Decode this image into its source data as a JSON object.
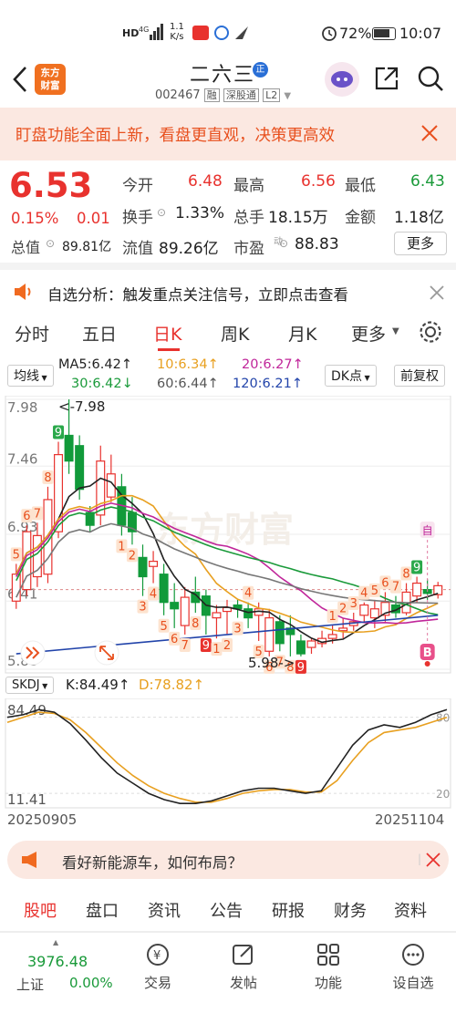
{
  "status_bar": {
    "net_speed": "1.1\nK/s",
    "battery": "72%",
    "time": "10:07"
  },
  "header": {
    "logo_text": "东方\n财富",
    "stock_name": "二六三",
    "badge": "正",
    "code": "002467",
    "tags": [
      "融",
      "深股通",
      "L2"
    ]
  },
  "banner": {
    "text": "盯盘功能全面上新，看盘更直观，决策更高效"
  },
  "quote": {
    "price": "6.53",
    "change_pct": "0.15%",
    "change_abs": "0.01",
    "open_label": "今开",
    "open": "6.48",
    "high_label": "最高",
    "high": "6.56",
    "low_label": "最低",
    "low": "6.43",
    "turnover_label": "换手",
    "turnover": "1.33%",
    "volume_label": "总手",
    "volume": "18.15万",
    "amount_label": "金额",
    "amount": "1.18亿",
    "mktcap_label": "总值",
    "mktcap": "89.81亿",
    "float_label": "流值",
    "float_cap": "89.26亿",
    "pe_label": "市盈",
    "pe": "88.83",
    "more": "更多"
  },
  "notice": {
    "text": "自选分析：触发重点关注信号，立即点击查看"
  },
  "chart_tabs": [
    "分时",
    "五日",
    "日K",
    "周K",
    "月K",
    "更多"
  ],
  "chart_tab_active": 2,
  "indicators": {
    "ma_type": "均线",
    "ma5": "MA5:6.42↑",
    "ma10": "10:6.34↑",
    "ma20": "20:6.27↑",
    "ma30": "30:6.42↓",
    "ma60": "60:6.44↑",
    "ma120": "120:6.21↑",
    "dk": "DK点",
    "adjust": "前复权",
    "colors": {
      "ma5": "#222222",
      "ma10": "#e8a020",
      "ma20": "#c0269a",
      "ma30": "#1a9a3a",
      "ma60": "#777777",
      "ma120": "#2244aa"
    }
  },
  "chart_data": {
    "type": "candlestick",
    "ylim": [
      5.88,
      7.98
    ],
    "y_ticks": [
      "7.98",
      "7.46",
      "6.93",
      "6.41",
      "5.88"
    ],
    "max_label": "<-7.98",
    "min_label": "5.98->",
    "watermark": "东方财富",
    "candles": [
      {
        "o": 6.41,
        "c": 6.62,
        "h": 6.7,
        "l": 6.35
      },
      {
        "o": 6.5,
        "c": 6.95,
        "h": 7.0,
        "l": 6.45
      },
      {
        "o": 6.6,
        "c": 6.92,
        "h": 7.02,
        "l": 6.52
      },
      {
        "o": 6.62,
        "c": 7.2,
        "h": 7.3,
        "l": 6.55
      },
      {
        "o": 6.95,
        "c": 7.55,
        "h": 7.65,
        "l": 6.9
      },
      {
        "o": 7.7,
        "c": 7.5,
        "h": 7.98,
        "l": 7.4
      },
      {
        "o": 7.62,
        "c": 7.28,
        "h": 7.7,
        "l": 7.2
      },
      {
        "o": 7.1,
        "c": 7.0,
        "h": 7.15,
        "l": 6.95
      },
      {
        "o": 7.08,
        "c": 7.5,
        "h": 7.62,
        "l": 7.0
      },
      {
        "o": 7.22,
        "c": 7.4,
        "h": 7.55,
        "l": 7.18
      },
      {
        "o": 7.3,
        "c": 7.0,
        "h": 7.4,
        "l": 6.92
      },
      {
        "o": 7.1,
        "c": 6.95,
        "h": 7.22,
        "l": 6.85
      },
      {
        "o": 6.75,
        "c": 6.6,
        "h": 6.85,
        "l": 6.45
      },
      {
        "o": 6.68,
        "c": 6.72,
        "h": 6.8,
        "l": 6.55
      },
      {
        "o": 6.62,
        "c": 6.4,
        "h": 6.7,
        "l": 6.3
      },
      {
        "o": 6.4,
        "c": 6.35,
        "h": 6.55,
        "l": 6.2
      },
      {
        "o": 6.22,
        "c": 6.44,
        "h": 6.52,
        "l": 6.15
      },
      {
        "o": 6.48,
        "c": 6.4,
        "h": 6.6,
        "l": 6.32
      },
      {
        "o": 6.45,
        "c": 6.3,
        "h": 6.5,
        "l": 6.15
      },
      {
        "o": 6.28,
        "c": 6.32,
        "h": 6.38,
        "l": 6.12
      },
      {
        "o": 6.33,
        "c": 6.36,
        "h": 6.42,
        "l": 6.15
      },
      {
        "o": 6.38,
        "c": 6.35,
        "h": 6.42,
        "l": 6.28
      },
      {
        "o": 6.35,
        "c": 6.28,
        "h": 6.4,
        "l": 6.2
      },
      {
        "o": 6.3,
        "c": 6.35,
        "h": 6.4,
        "l": 6.1
      },
      {
        "o": 6.02,
        "c": 6.28,
        "h": 6.35,
        "l": 5.98
      },
      {
        "o": 6.25,
        "c": 6.08,
        "h": 6.3,
        "l": 6.02
      },
      {
        "o": 6.2,
        "c": 6.15,
        "h": 6.3,
        "l": 5.98
      },
      {
        "o": 6.1,
        "c": 6.0,
        "h": 6.15,
        "l": 5.98
      },
      {
        "o": 6.05,
        "c": 6.1,
        "h": 6.12,
        "l": 6.0
      },
      {
        "o": 6.08,
        "c": 6.12,
        "h": 6.18,
        "l": 6.05
      },
      {
        "o": 6.12,
        "c": 6.15,
        "h": 6.22,
        "l": 6.08
      },
      {
        "o": 6.18,
        "c": 6.2,
        "h": 6.28,
        "l": 6.12
      },
      {
        "o": 6.22,
        "c": 6.25,
        "h": 6.32,
        "l": 6.18
      },
      {
        "o": 6.3,
        "c": 6.38,
        "h": 6.4,
        "l": 6.25
      },
      {
        "o": 6.28,
        "c": 6.35,
        "h": 6.42,
        "l": 6.2
      },
      {
        "o": 6.3,
        "c": 6.4,
        "h": 6.48,
        "l": 6.25
      },
      {
        "o": 6.38,
        "c": 6.32,
        "h": 6.45,
        "l": 6.28
      },
      {
        "o": 6.32,
        "c": 6.48,
        "h": 6.55,
        "l": 6.3
      },
      {
        "o": 6.45,
        "c": 6.55,
        "h": 6.6,
        "l": 6.4
      },
      {
        "o": 6.5,
        "c": 6.47,
        "h": 6.58,
        "l": 6.42
      },
      {
        "o": 6.46,
        "c": 6.53,
        "h": 6.56,
        "l": 6.43
      }
    ],
    "td_labels": [
      {
        "i": 0,
        "t": "5",
        "type": "buy"
      },
      {
        "i": 1,
        "t": "6",
        "type": "buy"
      },
      {
        "i": 2,
        "t": "7",
        "type": "buy"
      },
      {
        "i": 3,
        "t": "8",
        "type": "buy"
      },
      {
        "i": 4,
        "t": "9",
        "type": "buyg"
      },
      {
        "i": 10,
        "t": "1",
        "type": "sell"
      },
      {
        "i": 11,
        "t": "2",
        "type": "sell"
      },
      {
        "i": 12,
        "t": "3",
        "type": "sell"
      },
      {
        "i": 13,
        "t": "4",
        "type": "sell"
      },
      {
        "i": 14,
        "t": "5",
        "type": "sell"
      },
      {
        "i": 15,
        "t": "6",
        "type": "sell"
      },
      {
        "i": 16,
        "t": "7",
        "type": "sell"
      },
      {
        "i": 17,
        "t": "8",
        "type": "sell"
      },
      {
        "i": 18,
        "t": "9",
        "type": "sellr"
      },
      {
        "i": 19,
        "t": "1",
        "type": "sell"
      },
      {
        "i": 20,
        "t": "2",
        "type": "sell"
      },
      {
        "i": 21,
        "t": "3",
        "type": "sell"
      },
      {
        "i": 22,
        "t": "4",
        "type": "buy"
      },
      {
        "i": 23,
        "t": "5",
        "type": "sell"
      },
      {
        "i": 24,
        "t": "6",
        "type": "sell"
      },
      {
        "i": 25,
        "t": "7",
        "type": "sell"
      },
      {
        "i": 26,
        "t": "8",
        "type": "sell"
      },
      {
        "i": 27,
        "t": "9",
        "type": "sellr"
      },
      {
        "i": 30,
        "t": "1",
        "type": "buy"
      },
      {
        "i": 31,
        "t": "2",
        "type": "buy"
      },
      {
        "i": 32,
        "t": "3",
        "type": "buy"
      },
      {
        "i": 33,
        "t": "4",
        "type": "buy"
      },
      {
        "i": 34,
        "t": "5",
        "type": "buy"
      },
      {
        "i": 35,
        "t": "6",
        "type": "buy"
      },
      {
        "i": 36,
        "t": "7",
        "type": "buy"
      },
      {
        "i": 37,
        "t": "8",
        "type": "buy"
      },
      {
        "i": 38,
        "t": "9",
        "type": "buyg"
      }
    ],
    "signal_top": "自",
    "signal_b": "B"
  },
  "skdj": {
    "name": "SKDJ",
    "k": "K:84.49↑",
    "d": "D:78.82↑",
    "top": "84.49",
    "bottom": "11.41",
    "r80": "80",
    "r20": "20",
    "k_values": [
      80,
      82,
      86,
      84,
      75,
      62,
      48,
      36,
      28,
      20,
      15,
      12,
      12,
      14,
      18,
      22,
      24,
      24,
      22,
      20,
      22,
      40,
      58,
      70,
      74,
      72,
      76,
      82,
      86
    ],
    "d_values": [
      76,
      80,
      84,
      83,
      78,
      68,
      56,
      44,
      34,
      26,
      20,
      16,
      13,
      13,
      16,
      20,
      22,
      23,
      23,
      21,
      21,
      30,
      46,
      60,
      68,
      70,
      72,
      76,
      80
    ]
  },
  "dates": {
    "start": "20250905",
    "end": "20251104"
  },
  "promo": {
    "text": "看好新能源车，如何布局？"
  },
  "sub_tabs": [
    "股吧",
    "盘口",
    "资讯",
    "公告",
    "研报",
    "财务",
    "资料"
  ],
  "sub_tab_active": 0,
  "bottom_nav": {
    "index_value": "3976.48",
    "index_name": "上证",
    "index_change": "0.00%",
    "items": [
      "交易",
      "发帖",
      "功能",
      "设自选"
    ]
  }
}
